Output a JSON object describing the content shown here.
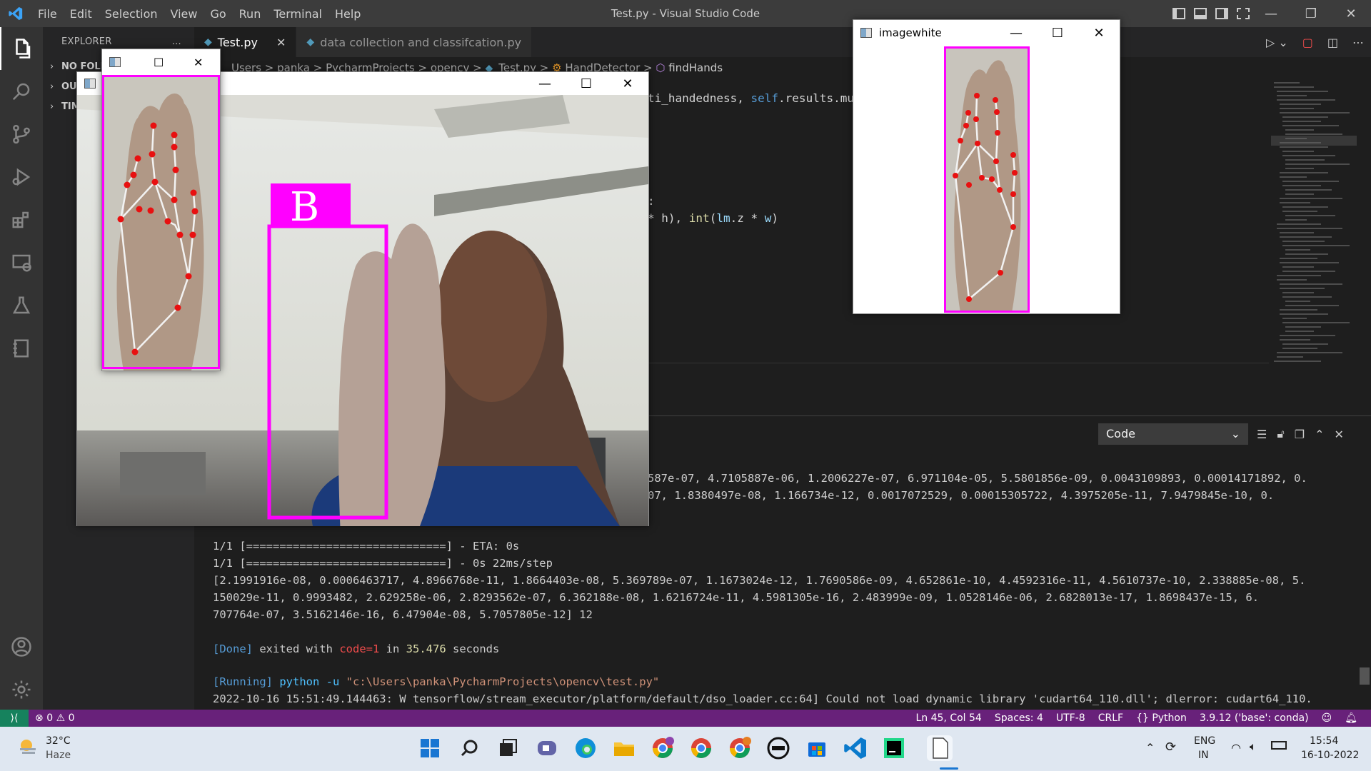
{
  "window": {
    "title": "Test.py - Visual Studio Code",
    "menu": [
      "File",
      "Edit",
      "Selection",
      "View",
      "Go",
      "Run",
      "Terminal",
      "Help"
    ]
  },
  "sidebar": {
    "header": "EXPLORER",
    "more": "...",
    "sections": [
      "NO FOLD",
      "OUT",
      "TIM"
    ]
  },
  "tabs": [
    {
      "label": "Test.py",
      "close": "✕"
    },
    {
      "label": "data collection and classifcation.py"
    }
  ],
  "breadcrumb": {
    "parts": [
      "Users",
      "panka",
      "PycharmProjects",
      "opencv",
      "Test.py",
      "HandDetector",
      "findHands"
    ],
    "separator": ">"
  },
  "editor": {
    "line1_a": "ti_handedness, ",
    "line1_b": "self",
    "line1_c": ".results.mu",
    "line2": ":",
    "line3_a": "* h), ",
    "line3_b": "int",
    "line3_c": "(",
    "line3_d": "lm",
    "line3_e": ".z * ",
    "line3_f": "w",
    "line3_g": ")"
  },
  "panel": {
    "select_value": "Code",
    "output_lines": [
      "587e-07, 4.7105887e-06, 1.2006227e-07, 6.971104e-05, 5.5801856e-09, 0.0043109893, 0.00014171892, 0.",
      "07, 1.8380497e-08, 1.166734e-12, 0.0017072529, 0.00015305722, 4.3975205e-11, 7.9479845e-10, 0.",
      "1/1 [==============================] - ETA: 0s",
      "1/1 [==============================] - 0s 22ms/step",
      "[2.1991916e-08, 0.0006463717, 4.8966768e-11, 1.8664403e-08, 5.369789e-07, 1.1673024e-12, 1.7690586e-09, 4.652861e-10, 4.4592316e-11, 4.5610737e-10, 2.338885e-08, 5.",
      "150029e-11, 0.9993482, 2.629258e-06, 2.8293562e-07, 6.362188e-08, 1.6216724e-11, 4.5981305e-16, 2.483999e-09, 1.0528146e-06, 2.6828013e-17, 1.8698437e-15, 6.",
      "707764e-07, 3.5162146e-16, 6.47904e-08, 5.7057805e-12] 12"
    ],
    "done_tag": "[Done]",
    "done_text_a": " exited with ",
    "done_code": "code=1",
    "done_text_b": " in ",
    "done_secs": "35.476",
    "done_text_c": " seconds",
    "running_tag": "[Running]",
    "running_cmd": " python -u ",
    "running_path": "\"c:\\Users\\panka\\PycharmProjects\\opencv\\test.py\"",
    "last_line": "2022-10-16 15:51:49.144463: W tensorflow/stream_executor/platform/default/dso_loader.cc:64] Could not load dynamic library 'cudart64_110.dll'; dlerror: cudart64_110."
  },
  "statusbar": {
    "errors": "0",
    "warnings": "0",
    "position": "Ln 45, Col 54",
    "spaces": "Spaces: 4",
    "encoding": "UTF-8",
    "eol": "CRLF",
    "language": "Python",
    "interpreter": "3.9.12 ('base': conda)"
  },
  "taskbar": {
    "temp": "32°C",
    "weather": "Haze",
    "lang1": "ENG",
    "lang2": "IN",
    "time": "15:54",
    "date": "16-10-2022"
  },
  "cv_main": {
    "label": "B"
  },
  "cv_white": {
    "title": "imagewhite"
  },
  "colors": {
    "accent_magenta": "#ff00ff",
    "statusbar": "#68217a",
    "landmark": "#e81010"
  }
}
